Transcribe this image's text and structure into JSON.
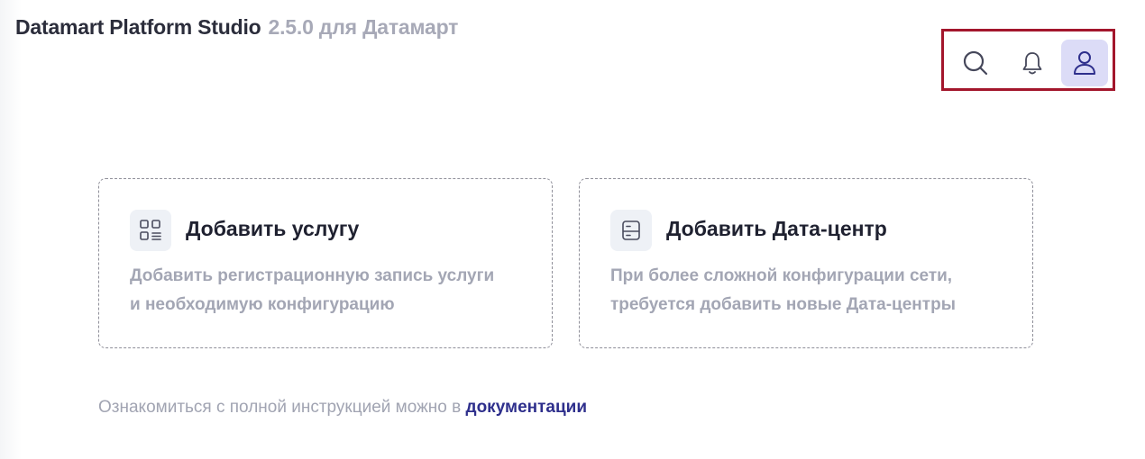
{
  "header": {
    "app_name": "Datamart Platform Studio",
    "version_suffix": "2.5.0 для Датамарт"
  },
  "header_actions": {
    "search_icon": "search-icon",
    "notifications_icon": "bell-icon",
    "profile_icon": "user-icon",
    "profile_bg_color": "#dcdcf7",
    "highlight_border_color": "#a3162c"
  },
  "cards": [
    {
      "icon": "services-grid-icon",
      "title": "Добавить услугу",
      "description_lines": [
        "Добавить регистрационную запись услуги",
        "и необходимую конфигурацию"
      ]
    },
    {
      "icon": "server-icon",
      "title": "Добавить Дата-центр",
      "description_lines": [
        "При более сложной конфигурации сети,",
        "требуется добавить новые Дата-центры"
      ]
    }
  ],
  "footer": {
    "text": "Ознакомиться с полной инструкцией можно в ",
    "link_text": "документации",
    "link_color": "#2e2f8c"
  }
}
